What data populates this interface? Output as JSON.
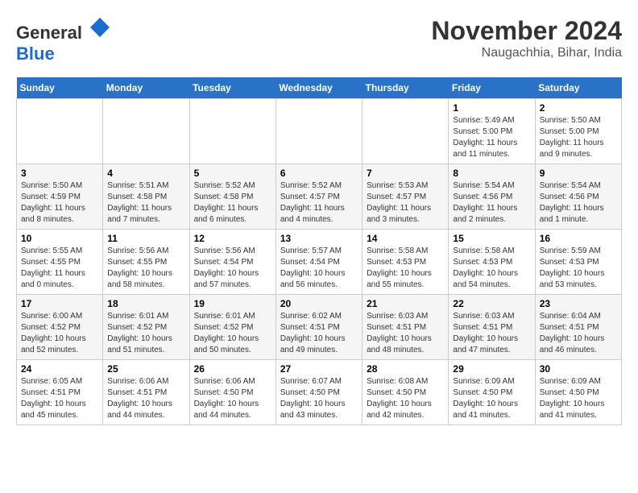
{
  "logo": {
    "general": "General",
    "blue": "Blue"
  },
  "title": "November 2024",
  "location": "Naugachhia, Bihar, India",
  "weekdays": [
    "Sunday",
    "Monday",
    "Tuesday",
    "Wednesday",
    "Thursday",
    "Friday",
    "Saturday"
  ],
  "weeks": [
    [
      {
        "day": "",
        "sunrise": "",
        "sunset": "",
        "daylight": ""
      },
      {
        "day": "",
        "sunrise": "",
        "sunset": "",
        "daylight": ""
      },
      {
        "day": "",
        "sunrise": "",
        "sunset": "",
        "daylight": ""
      },
      {
        "day": "",
        "sunrise": "",
        "sunset": "",
        "daylight": ""
      },
      {
        "day": "",
        "sunrise": "",
        "sunset": "",
        "daylight": ""
      },
      {
        "day": "1",
        "sunrise": "Sunrise: 5:49 AM",
        "sunset": "Sunset: 5:00 PM",
        "daylight": "Daylight: 11 hours and 11 minutes."
      },
      {
        "day": "2",
        "sunrise": "Sunrise: 5:50 AM",
        "sunset": "Sunset: 5:00 PM",
        "daylight": "Daylight: 11 hours and 9 minutes."
      }
    ],
    [
      {
        "day": "3",
        "sunrise": "Sunrise: 5:50 AM",
        "sunset": "Sunset: 4:59 PM",
        "daylight": "Daylight: 11 hours and 8 minutes."
      },
      {
        "day": "4",
        "sunrise": "Sunrise: 5:51 AM",
        "sunset": "Sunset: 4:58 PM",
        "daylight": "Daylight: 11 hours and 7 minutes."
      },
      {
        "day": "5",
        "sunrise": "Sunrise: 5:52 AM",
        "sunset": "Sunset: 4:58 PM",
        "daylight": "Daylight: 11 hours and 6 minutes."
      },
      {
        "day": "6",
        "sunrise": "Sunrise: 5:52 AM",
        "sunset": "Sunset: 4:57 PM",
        "daylight": "Daylight: 11 hours and 4 minutes."
      },
      {
        "day": "7",
        "sunrise": "Sunrise: 5:53 AM",
        "sunset": "Sunset: 4:57 PM",
        "daylight": "Daylight: 11 hours and 3 minutes."
      },
      {
        "day": "8",
        "sunrise": "Sunrise: 5:54 AM",
        "sunset": "Sunset: 4:56 PM",
        "daylight": "Daylight: 11 hours and 2 minutes."
      },
      {
        "day": "9",
        "sunrise": "Sunrise: 5:54 AM",
        "sunset": "Sunset: 4:56 PM",
        "daylight": "Daylight: 11 hours and 1 minute."
      }
    ],
    [
      {
        "day": "10",
        "sunrise": "Sunrise: 5:55 AM",
        "sunset": "Sunset: 4:55 PM",
        "daylight": "Daylight: 11 hours and 0 minutes."
      },
      {
        "day": "11",
        "sunrise": "Sunrise: 5:56 AM",
        "sunset": "Sunset: 4:55 PM",
        "daylight": "Daylight: 10 hours and 58 minutes."
      },
      {
        "day": "12",
        "sunrise": "Sunrise: 5:56 AM",
        "sunset": "Sunset: 4:54 PM",
        "daylight": "Daylight: 10 hours and 57 minutes."
      },
      {
        "day": "13",
        "sunrise": "Sunrise: 5:57 AM",
        "sunset": "Sunset: 4:54 PM",
        "daylight": "Daylight: 10 hours and 56 minutes."
      },
      {
        "day": "14",
        "sunrise": "Sunrise: 5:58 AM",
        "sunset": "Sunset: 4:53 PM",
        "daylight": "Daylight: 10 hours and 55 minutes."
      },
      {
        "day": "15",
        "sunrise": "Sunrise: 5:58 AM",
        "sunset": "Sunset: 4:53 PM",
        "daylight": "Daylight: 10 hours and 54 minutes."
      },
      {
        "day": "16",
        "sunrise": "Sunrise: 5:59 AM",
        "sunset": "Sunset: 4:53 PM",
        "daylight": "Daylight: 10 hours and 53 minutes."
      }
    ],
    [
      {
        "day": "17",
        "sunrise": "Sunrise: 6:00 AM",
        "sunset": "Sunset: 4:52 PM",
        "daylight": "Daylight: 10 hours and 52 minutes."
      },
      {
        "day": "18",
        "sunrise": "Sunrise: 6:01 AM",
        "sunset": "Sunset: 4:52 PM",
        "daylight": "Daylight: 10 hours and 51 minutes."
      },
      {
        "day": "19",
        "sunrise": "Sunrise: 6:01 AM",
        "sunset": "Sunset: 4:52 PM",
        "daylight": "Daylight: 10 hours and 50 minutes."
      },
      {
        "day": "20",
        "sunrise": "Sunrise: 6:02 AM",
        "sunset": "Sunset: 4:51 PM",
        "daylight": "Daylight: 10 hours and 49 minutes."
      },
      {
        "day": "21",
        "sunrise": "Sunrise: 6:03 AM",
        "sunset": "Sunset: 4:51 PM",
        "daylight": "Daylight: 10 hours and 48 minutes."
      },
      {
        "day": "22",
        "sunrise": "Sunrise: 6:03 AM",
        "sunset": "Sunset: 4:51 PM",
        "daylight": "Daylight: 10 hours and 47 minutes."
      },
      {
        "day": "23",
        "sunrise": "Sunrise: 6:04 AM",
        "sunset": "Sunset: 4:51 PM",
        "daylight": "Daylight: 10 hours and 46 minutes."
      }
    ],
    [
      {
        "day": "24",
        "sunrise": "Sunrise: 6:05 AM",
        "sunset": "Sunset: 4:51 PM",
        "daylight": "Daylight: 10 hours and 45 minutes."
      },
      {
        "day": "25",
        "sunrise": "Sunrise: 6:06 AM",
        "sunset": "Sunset: 4:51 PM",
        "daylight": "Daylight: 10 hours and 44 minutes."
      },
      {
        "day": "26",
        "sunrise": "Sunrise: 6:06 AM",
        "sunset": "Sunset: 4:50 PM",
        "daylight": "Daylight: 10 hours and 44 minutes."
      },
      {
        "day": "27",
        "sunrise": "Sunrise: 6:07 AM",
        "sunset": "Sunset: 4:50 PM",
        "daylight": "Daylight: 10 hours and 43 minutes."
      },
      {
        "day": "28",
        "sunrise": "Sunrise: 6:08 AM",
        "sunset": "Sunset: 4:50 PM",
        "daylight": "Daylight: 10 hours and 42 minutes."
      },
      {
        "day": "29",
        "sunrise": "Sunrise: 6:09 AM",
        "sunset": "Sunset: 4:50 PM",
        "daylight": "Daylight: 10 hours and 41 minutes."
      },
      {
        "day": "30",
        "sunrise": "Sunrise: 6:09 AM",
        "sunset": "Sunset: 4:50 PM",
        "daylight": "Daylight: 10 hours and 41 minutes."
      }
    ]
  ]
}
